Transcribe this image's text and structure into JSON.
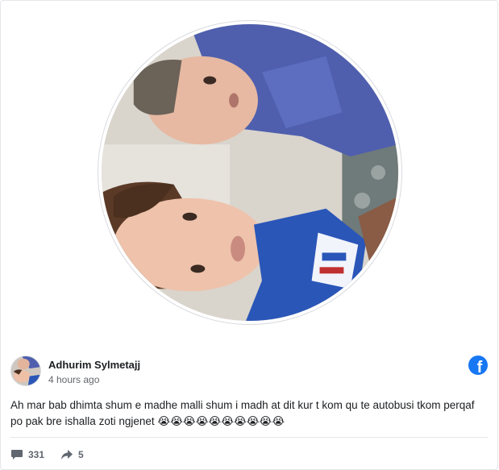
{
  "post": {
    "author_name": "Adhurim Sylmetajj",
    "time": "4 hours ago",
    "text": "Ah mar bab dhimta shum e madhe malli shum i madh at dit kur t kom qu te autobusi tkom perqaf po pak bre ishalla zoti ngjenet 😭😭😭😭😭😭😭😭😭😭",
    "comments_count": "331",
    "shares_count": "5"
  },
  "icons": {
    "platform": "facebook-icon",
    "comments": "comment-icon",
    "shares": "share-arrow-icon"
  },
  "colors": {
    "facebook_blue": "#1877f2",
    "meta_gray": "#65676b",
    "stat_gray": "#606770"
  }
}
